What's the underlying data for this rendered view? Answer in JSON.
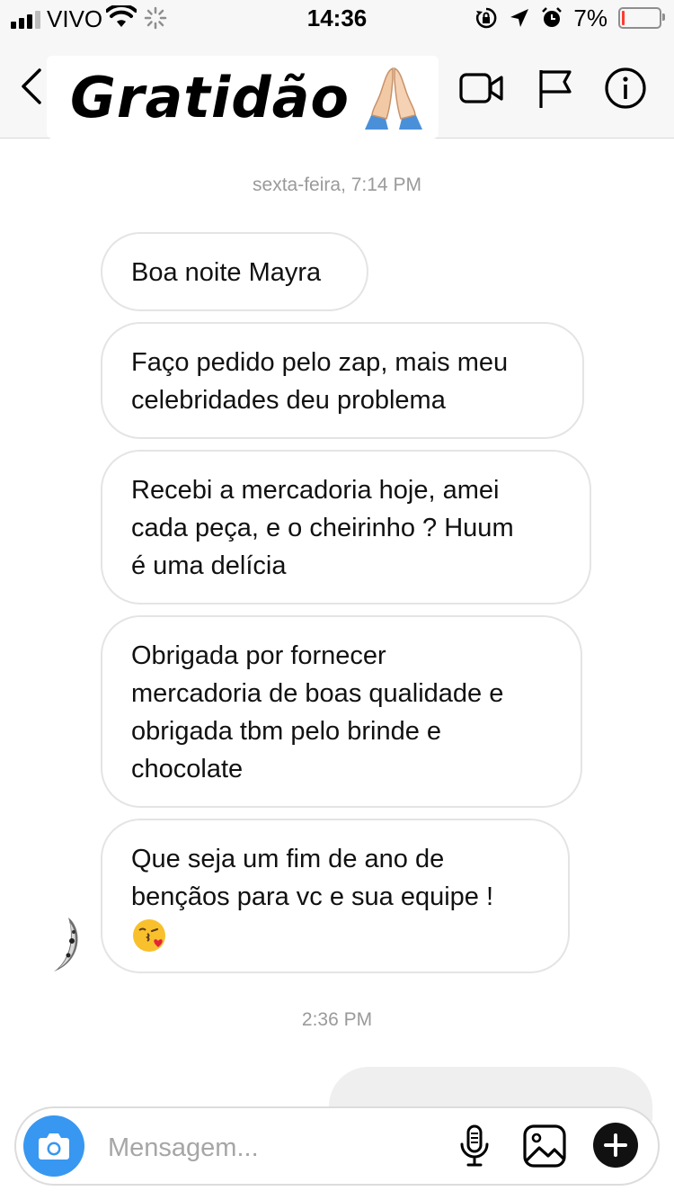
{
  "status_bar": {
    "carrier": "VIVO",
    "time": "14:36",
    "battery_percent": "7%",
    "battery_level": 0.07,
    "signal_bars": 3,
    "icons": [
      "wifi-icon",
      "loading-icon",
      "screen-rotation-lock-icon",
      "location-arrow-icon",
      "alarm-icon",
      "battery-icon"
    ]
  },
  "header": {
    "title": "Gratidão",
    "title_emoji": "folded-hands-emoji",
    "icons": [
      "back-chevron-icon",
      "video-call-icon",
      "flag-icon",
      "info-icon"
    ]
  },
  "conversation": {
    "first_timestamp": "sexta-feira, 7:14 PM",
    "incoming_messages": [
      {
        "lines": [
          "Boa noite Mayra"
        ]
      },
      {
        "lines": [
          "Faço pedido pelo zap, mais meu",
          "celebridades deu problema"
        ]
      },
      {
        "lines": [
          "Recebi a mercadoria hoje, amei",
          "cada peça, e o cheirinho ? Huum",
          "é uma delícia"
        ]
      },
      {
        "lines": [
          "Obrigada por fornecer",
          "mercadoria de boas qualidade e",
          "obrigada tbm pelo brinde e",
          "chocolate"
        ]
      },
      {
        "lines": [
          "Que seja um fim de ano de",
          "bençãos para vc e sua equipe !"
        ],
        "emoji": "face-blowing-kiss-emoji"
      }
    ],
    "second_timestamp": "2:36 PM"
  },
  "composer": {
    "placeholder": "Mensagem...",
    "icons": [
      "camera-icon",
      "microphone-icon",
      "gallery-icon",
      "plus-icon"
    ]
  },
  "colors": {
    "accent": "#3897f0",
    "bubble_border": "#e4e4e4",
    "timestamp": "#9a9a9a",
    "battery_low": "#ff3b30"
  }
}
